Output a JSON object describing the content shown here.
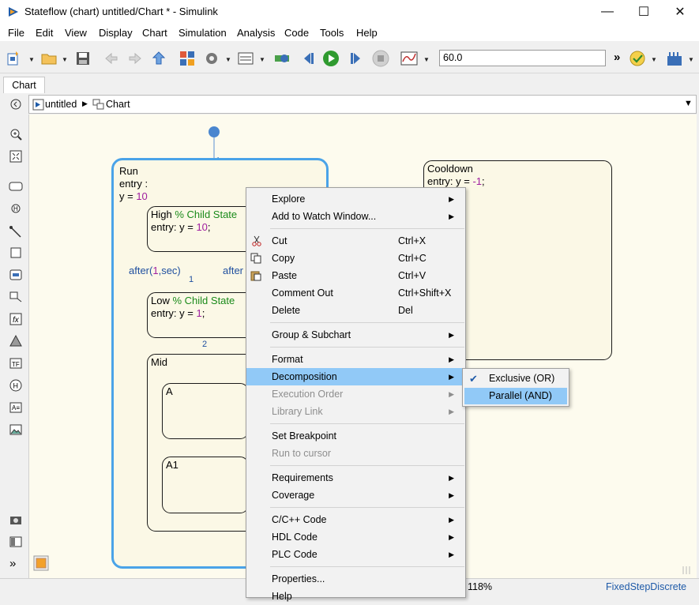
{
  "window": {
    "title": "Stateflow (chart) untitled/Chart * - Simulink",
    "minimize_glyph": "—",
    "maximize_glyph": "☐",
    "close_glyph": "✕"
  },
  "menubar": {
    "items": [
      "File",
      "Edit",
      "View",
      "Display",
      "Chart",
      "Simulation",
      "Analysis",
      "Code",
      "Tools",
      "Help"
    ]
  },
  "toolbar": {
    "stop_time": "60.0",
    "overflow_glyph": "»"
  },
  "tabs": [
    "Chart"
  ],
  "breadcrumb": {
    "model": "untitled",
    "chart": "Chart"
  },
  "chart": {
    "run_state": {
      "name": "Run",
      "entry_kw": "entry :",
      "entry_var": "y = ",
      "entry_val": "10"
    },
    "high_state": {
      "name": "High",
      "comment": "% Child State",
      "entry_prefix": "entry: y = ",
      "entry_val": "10",
      "entry_suffix": ";"
    },
    "low_state": {
      "name": "Low",
      "comment": "% Child State",
      "entry_prefix": "entry: y = ",
      "entry_val": "1",
      "entry_suffix": ";"
    },
    "mid_state": {
      "name": "Mid"
    },
    "a_state": {
      "name": "A"
    },
    "a1_state": {
      "name": "A1"
    },
    "cooldown_state": {
      "name": "Cooldown",
      "entry_prefix": "entry: y = ",
      "entry_val": "-1",
      "entry_suffix": ";"
    },
    "transition_after_left": {
      "prefix": "after(",
      "num": "1",
      "suffix": ",sec)"
    },
    "transition_after_right": "after",
    "order_1": "1",
    "order_2": "2"
  },
  "context_menu": {
    "items": [
      {
        "label": "Explore",
        "shortcut": "",
        "submenu": true,
        "disabled": false
      },
      {
        "label": "Add to Watch Window...",
        "shortcut": "",
        "submenu": true,
        "disabled": false
      },
      {
        "label": "Cut",
        "shortcut": "Ctrl+X",
        "submenu": false,
        "disabled": false,
        "icon": "scissors-icon"
      },
      {
        "label": "Copy",
        "shortcut": "Ctrl+C",
        "submenu": false,
        "disabled": false,
        "icon": "copy-icon"
      },
      {
        "label": "Paste",
        "shortcut": "Ctrl+V",
        "submenu": false,
        "disabled": false,
        "icon": "paste-icon"
      },
      {
        "label": "Comment Out",
        "shortcut": "Ctrl+Shift+X",
        "submenu": false,
        "disabled": false
      },
      {
        "label": "Delete",
        "shortcut": "Del",
        "submenu": false,
        "disabled": false
      },
      {
        "label": "Group & Subchart",
        "shortcut": "",
        "submenu": true,
        "disabled": false
      },
      {
        "label": "Format",
        "shortcut": "",
        "submenu": true,
        "disabled": false
      },
      {
        "label": "Decomposition",
        "shortcut": "",
        "submenu": true,
        "disabled": false,
        "highlighted": true
      },
      {
        "label": "Execution Order",
        "shortcut": "",
        "submenu": true,
        "disabled": true
      },
      {
        "label": "Library Link",
        "shortcut": "",
        "submenu": true,
        "disabled": true
      },
      {
        "label": "Set Breakpoint",
        "shortcut": "",
        "submenu": false,
        "disabled": false
      },
      {
        "label": "Run to cursor",
        "shortcut": "",
        "submenu": false,
        "disabled": true
      },
      {
        "label": "Requirements",
        "shortcut": "",
        "submenu": true,
        "disabled": false
      },
      {
        "label": "Coverage",
        "shortcut": "",
        "submenu": true,
        "disabled": false
      },
      {
        "label": "C/C++ Code",
        "shortcut": "",
        "submenu": true,
        "disabled": false
      },
      {
        "label": "HDL Code",
        "shortcut": "",
        "submenu": true,
        "disabled": false
      },
      {
        "label": "PLC Code",
        "shortcut": "",
        "submenu": true,
        "disabled": false
      },
      {
        "label": "Properties...",
        "shortcut": "",
        "submenu": false,
        "disabled": false
      },
      {
        "label": "Help",
        "shortcut": "",
        "submenu": false,
        "disabled": false
      }
    ],
    "submenu_glyph": "▶"
  },
  "decomposition_submenu": {
    "items": [
      {
        "label": "Exclusive (OR)",
        "checked": true
      },
      {
        "label": "Parallel (AND)",
        "checked": false,
        "highlighted": true
      }
    ],
    "check_glyph": "✔"
  },
  "statusbar": {
    "zoom": "118%",
    "solver": "FixedStepDiscrete"
  },
  "colors": {
    "selection_blue": "#4aa3e8",
    "menu_highlight": "#91c9f7",
    "canvas_bg": "#fdfbee",
    "transition_blue": "#5b8fd1",
    "keyword_purple": "#a020a0",
    "comment_green": "#1a8a1a"
  }
}
